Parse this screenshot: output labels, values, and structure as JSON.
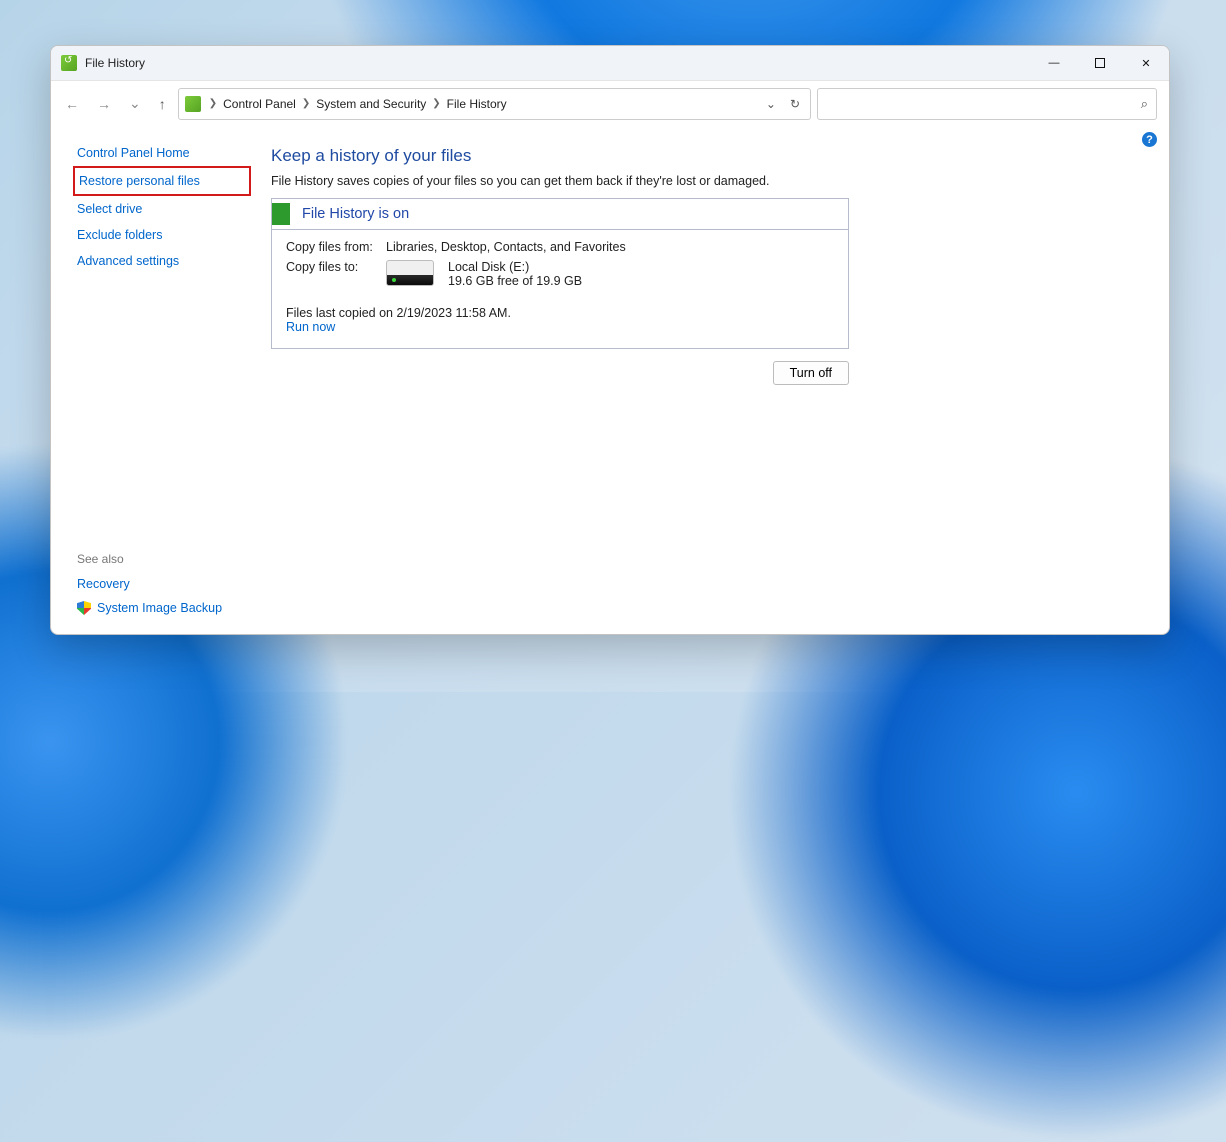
{
  "window": {
    "title": "File History"
  },
  "breadcrumb": {
    "items": [
      "Control Panel",
      "System and Security",
      "File History"
    ]
  },
  "sidebar": {
    "links": [
      "Control Panel Home",
      "Restore personal files",
      "Select drive",
      "Exclude folders",
      "Advanced settings"
    ],
    "see_also_header": "See also",
    "see_also": [
      "Recovery",
      "System Image Backup"
    ]
  },
  "main": {
    "heading": "Keep a history of your files",
    "subheading": "File History saves copies of your files so you can get them back if they're lost or damaged.",
    "status_title": "File History is on",
    "copy_from_label": "Copy files from:",
    "copy_from_value": "Libraries, Desktop, Contacts, and Favorites",
    "copy_to_label": "Copy files to:",
    "disk_name": "Local Disk (E:)",
    "disk_space": "19.6 GB free of 19.9 GB",
    "last_copied": "Files last copied on 2/19/2023 11:58 AM.",
    "run_now": "Run now",
    "turn_off": "Turn off"
  }
}
